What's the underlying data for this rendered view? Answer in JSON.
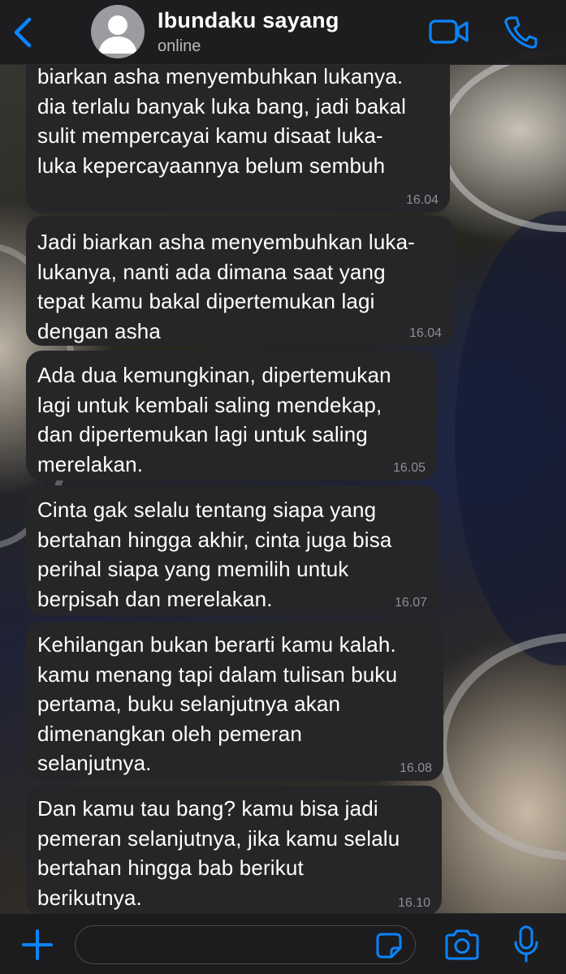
{
  "header": {
    "contact_name": "Ibundaku sayang",
    "status": "online",
    "icons": {
      "back": "chevron-left-icon",
      "video": "video-camera-icon",
      "call": "phone-icon"
    }
  },
  "messages": [
    {
      "text": "biarkan asha menyembuhkan lukanya.\ndia terlalu banyak luka bang, jadi bakal\nsulit mempercayai kamu disaat luka-\nluka kepercayaannya belum sembuh",
      "time": "16.04"
    },
    {
      "text": "Jadi biarkan asha menyembuhkan luka-\nlukanya, nanti ada dimana saat yang\ntepat kamu bakal dipertemukan lagi\ndengan asha",
      "time": "16.04"
    },
    {
      "text": "Ada dua kemungkinan, dipertemukan\nlagi untuk kembali saling mendekap,\ndan dipertemukan lagi untuk saling\nmerelakan.",
      "time": "16.05"
    },
    {
      "text": "Cinta gak selalu tentang siapa yang\nbertahan hingga akhir, cinta juga bisa\nperihal siapa yang memilih untuk\nberpisah dan merelakan.",
      "time": "16.07"
    },
    {
      "text": "Kehilangan bukan berarti kamu kalah.\nkamu menang tapi dalam tulisan buku\npertama, buku selanjutnya akan\ndimenangkan oleh pemeran\nselanjutnya.",
      "time": "16.08"
    },
    {
      "text": "Dan kamu tau bang? kamu bisa jadi\npemeran selanjutnya, jika kamu selalu\nbertahan hingga bab berikut\nberikutnya.",
      "time": "16.10"
    }
  ],
  "composer": {
    "placeholder": "",
    "icons": {
      "attach": "plus-icon",
      "sticker": "sticker-icon",
      "camera": "camera-icon",
      "voice": "microphone-icon"
    }
  },
  "colors": {
    "accent": "#0a84ff",
    "bubble": "#262628",
    "bar": "#1c1c1e",
    "timestamp": "#8e8e93"
  }
}
